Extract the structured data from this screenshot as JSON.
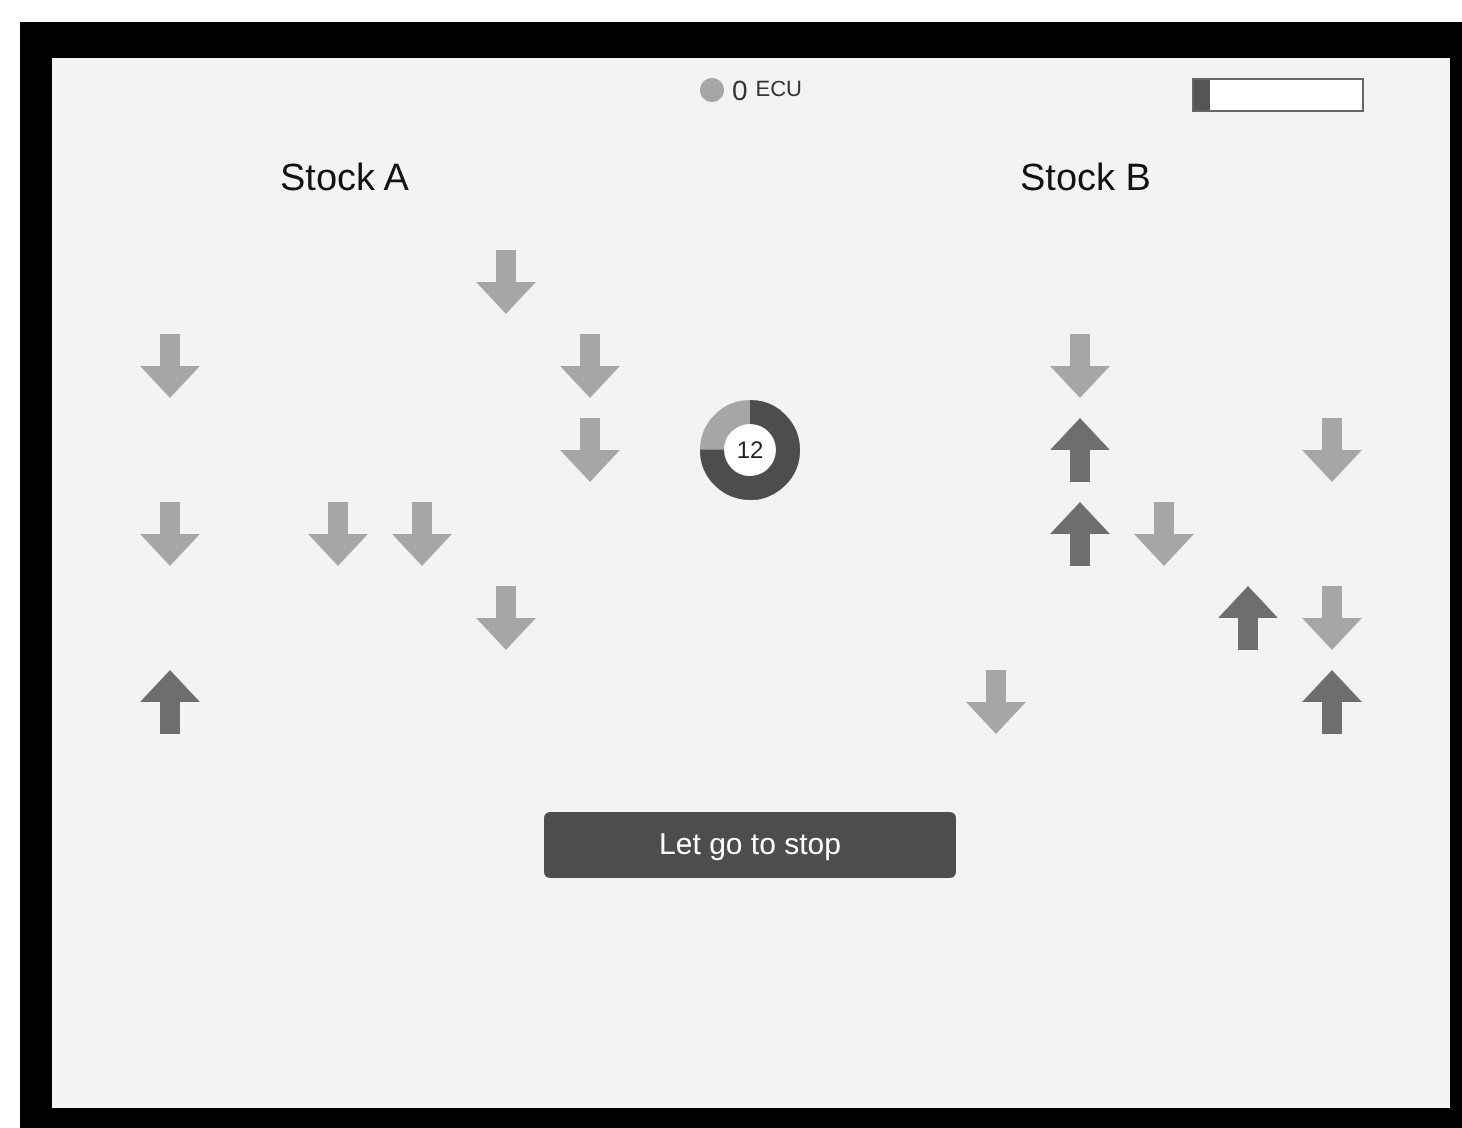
{
  "header": {
    "amount": "0",
    "unit": "ECU",
    "progress": {
      "level": 0.1
    }
  },
  "stocks": [
    {
      "label": "Stock A",
      "rows": [
        [
          {
            "kind": "blank"
          },
          {
            "kind": "blank"
          },
          {
            "kind": "blank"
          },
          {
            "kind": "blank"
          },
          {
            "kind": "down"
          },
          {
            "kind": "blank"
          }
        ],
        [
          {
            "kind": "down"
          },
          {
            "kind": "blank"
          },
          {
            "kind": "blank"
          },
          {
            "kind": "blank"
          },
          {
            "kind": "blank"
          },
          {
            "kind": "down"
          }
        ],
        [
          {
            "kind": "blank"
          },
          {
            "kind": "blank"
          },
          {
            "kind": "blank"
          },
          {
            "kind": "blank"
          },
          {
            "kind": "blank"
          },
          {
            "kind": "down"
          }
        ],
        [
          {
            "kind": "down"
          },
          {
            "kind": "blank"
          },
          {
            "kind": "down"
          },
          {
            "kind": "down"
          },
          {
            "kind": "blank"
          },
          {
            "kind": "blank"
          }
        ],
        [
          {
            "kind": "blank"
          },
          {
            "kind": "blank"
          },
          {
            "kind": "blank"
          },
          {
            "kind": "blank"
          },
          {
            "kind": "down"
          },
          {
            "kind": "blank"
          }
        ],
        [
          {
            "kind": "up"
          },
          {
            "kind": "blank"
          },
          {
            "kind": "blank"
          },
          {
            "kind": "blank"
          },
          {
            "kind": "blank"
          },
          {
            "kind": "blank"
          }
        ]
      ]
    },
    {
      "label": "Stock B",
      "rows": [
        [
          {
            "kind": "blank"
          },
          {
            "kind": "blank"
          },
          {
            "kind": "blank"
          },
          {
            "kind": "blank"
          },
          {
            "kind": "blank"
          }
        ],
        [
          {
            "kind": "blank"
          },
          {
            "kind": "down"
          },
          {
            "kind": "blank"
          },
          {
            "kind": "blank"
          },
          {
            "kind": "blank"
          }
        ],
        [
          {
            "kind": "blank"
          },
          {
            "kind": "up"
          },
          {
            "kind": "blank"
          },
          {
            "kind": "blank"
          },
          {
            "kind": "down"
          }
        ],
        [
          {
            "kind": "blank"
          },
          {
            "kind": "up"
          },
          {
            "kind": "down"
          },
          {
            "kind": "blank"
          },
          {
            "kind": "blank"
          }
        ],
        [
          {
            "kind": "blank"
          },
          {
            "kind": "blank"
          },
          {
            "kind": "blank"
          },
          {
            "kind": "up"
          },
          {
            "kind": "down"
          }
        ],
        [
          {
            "kind": "down"
          },
          {
            "kind": "blank"
          },
          {
            "kind": "blank"
          },
          {
            "kind": "blank"
          },
          {
            "kind": "up"
          }
        ]
      ]
    }
  ],
  "timer": {
    "value": "12",
    "level": 0.75
  },
  "button": {
    "label": "Let go to stop"
  }
}
